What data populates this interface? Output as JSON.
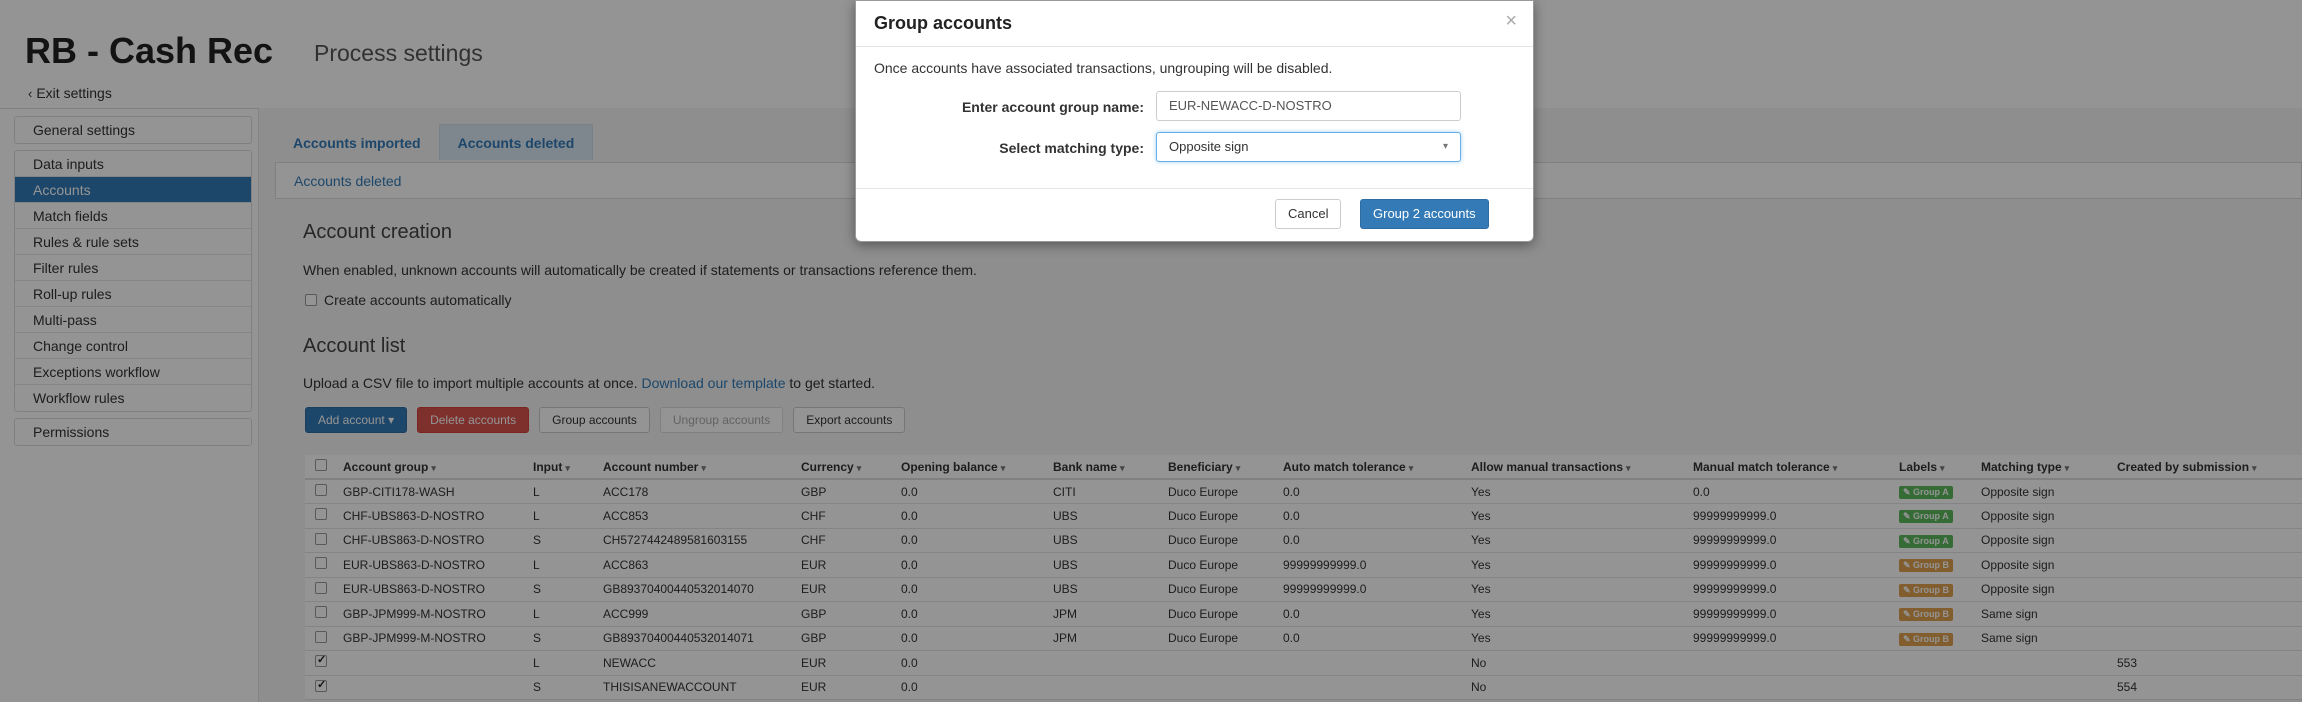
{
  "header": {
    "title": "RB - Cash Rec",
    "subtitle": "Process settings",
    "exit_label": "Exit settings"
  },
  "sidebar": {
    "group1": [
      "General settings"
    ],
    "group2": [
      "Data inputs",
      "Accounts",
      "Match fields",
      "Rules & rule sets",
      "Filter rules",
      "Roll-up rules",
      "Multi-pass",
      "Change control",
      "Exceptions workflow",
      "Workflow rules"
    ],
    "group3": [
      "Permissions"
    ],
    "active": "Accounts"
  },
  "tabs": [
    "Accounts imported",
    "Accounts deleted"
  ],
  "active_tab": "Accounts deleted",
  "breadcrumb": "Accounts deleted",
  "account_creation": {
    "heading": "Account creation",
    "description": "When enabled, unknown accounts will automatically be created if statements or transactions reference them.",
    "checkbox_label": "Create accounts automatically"
  },
  "account_list": {
    "heading": "Account list",
    "upload_text_before": "Upload a CSV file to import multiple accounts at once.",
    "upload_link": "Download our template",
    "upload_text_after": "to get started."
  },
  "toolbar": {
    "add_account": "Add account",
    "delete_accounts": "Delete accounts",
    "group_accounts": "Group accounts",
    "ungroup_accounts": "Ungroup accounts",
    "export_accounts": "Export accounts"
  },
  "table": {
    "columns": [
      "Account group",
      "Input",
      "Account number",
      "Currency",
      "Opening balance",
      "Bank name",
      "Beneficiary",
      "Auto match tolerance",
      "Allow manual transactions",
      "Manual match tolerance",
      "Labels",
      "Matching type",
      "Created by submission"
    ],
    "rows": [
      {
        "checked": false,
        "group": "GBP-CITI178-WASH",
        "input": "L",
        "number": "ACC178",
        "currency": "GBP",
        "opening": "0.0",
        "bank": "CITI",
        "beneficiary": "Duco Europe",
        "auto": "0.0",
        "manual_tx": "Yes",
        "manual_tol": "0.0",
        "label": "Group A",
        "label_color": "green",
        "matching": "Opposite sign",
        "submission": ""
      },
      {
        "checked": false,
        "group": "CHF-UBS863-D-NOSTRO",
        "input": "L",
        "number": "ACC853",
        "currency": "CHF",
        "opening": "0.0",
        "bank": "UBS",
        "beneficiary": "Duco Europe",
        "auto": "0.0",
        "manual_tx": "Yes",
        "manual_tol": "99999999999.0",
        "label": "Group A",
        "label_color": "green",
        "matching": "Opposite sign",
        "submission": ""
      },
      {
        "checked": false,
        "group": "CHF-UBS863-D-NOSTRO",
        "input": "S",
        "number": "CH5727442489581603155",
        "currency": "CHF",
        "opening": "0.0",
        "bank": "UBS",
        "beneficiary": "Duco Europe",
        "auto": "0.0",
        "manual_tx": "Yes",
        "manual_tol": "99999999999.0",
        "label": "Group A",
        "label_color": "green",
        "matching": "Opposite sign",
        "submission": ""
      },
      {
        "checked": false,
        "group": "EUR-UBS863-D-NOSTRO",
        "input": "L",
        "number": "ACC863",
        "currency": "EUR",
        "opening": "0.0",
        "bank": "UBS",
        "beneficiary": "Duco Europe",
        "auto": "99999999999.0",
        "manual_tx": "Yes",
        "manual_tol": "99999999999.0",
        "label": "Group B",
        "label_color": "orange",
        "matching": "Opposite sign",
        "submission": ""
      },
      {
        "checked": false,
        "group": "EUR-UBS863-D-NOSTRO",
        "input": "S",
        "number": "GB89370400440532014070",
        "currency": "EUR",
        "opening": "0.0",
        "bank": "UBS",
        "beneficiary": "Duco Europe",
        "auto": "99999999999.0",
        "manual_tx": "Yes",
        "manual_tol": "99999999999.0",
        "label": "Group B",
        "label_color": "orange",
        "matching": "Opposite sign",
        "submission": ""
      },
      {
        "checked": false,
        "group": "GBP-JPM999-M-NOSTRO",
        "input": "L",
        "number": "ACC999",
        "currency": "GBP",
        "opening": "0.0",
        "bank": "JPM",
        "beneficiary": "Duco Europe",
        "auto": "0.0",
        "manual_tx": "Yes",
        "manual_tol": "99999999999.0",
        "label": "Group B",
        "label_color": "orange",
        "matching": "Same sign",
        "submission": ""
      },
      {
        "checked": false,
        "group": "GBP-JPM999-M-NOSTRO",
        "input": "S",
        "number": "GB89370400440532014071",
        "currency": "GBP",
        "opening": "0.0",
        "bank": "JPM",
        "beneficiary": "Duco Europe",
        "auto": "0.0",
        "manual_tx": "Yes",
        "manual_tol": "99999999999.0",
        "label": "Group B",
        "label_color": "orange",
        "matching": "Same sign",
        "submission": ""
      },
      {
        "checked": true,
        "group": "",
        "input": "L",
        "number": "NEWACC",
        "currency": "EUR",
        "opening": "0.0",
        "bank": "",
        "beneficiary": "",
        "auto": "",
        "manual_tx": "No",
        "manual_tol": "",
        "label": "",
        "label_color": "",
        "matching": "",
        "submission": "553"
      },
      {
        "checked": true,
        "group": "",
        "input": "S",
        "number": "THISISANEWACCOUNT",
        "currency": "EUR",
        "opening": "0.0",
        "bank": "",
        "beneficiary": "",
        "auto": "",
        "manual_tx": "No",
        "manual_tol": "",
        "label": "",
        "label_color": "",
        "matching": "",
        "submission": "554"
      }
    ]
  },
  "modal": {
    "title": "Group accounts",
    "close_icon": "×",
    "note": "Once accounts have associated transactions, ungrouping will be disabled.",
    "group_name_label": "Enter account group name:",
    "group_name_value": "EUR-NEWACC-D-NOSTRO",
    "matching_type_label": "Select matching type:",
    "matching_type_value": "Opposite sign",
    "cancel_label": "Cancel",
    "confirm_label": "Group 2 accounts"
  },
  "colors": {
    "primary": "#337ab7",
    "danger": "#d9534f",
    "label_green": "#5cb85c",
    "label_orange": "#e0a050"
  }
}
